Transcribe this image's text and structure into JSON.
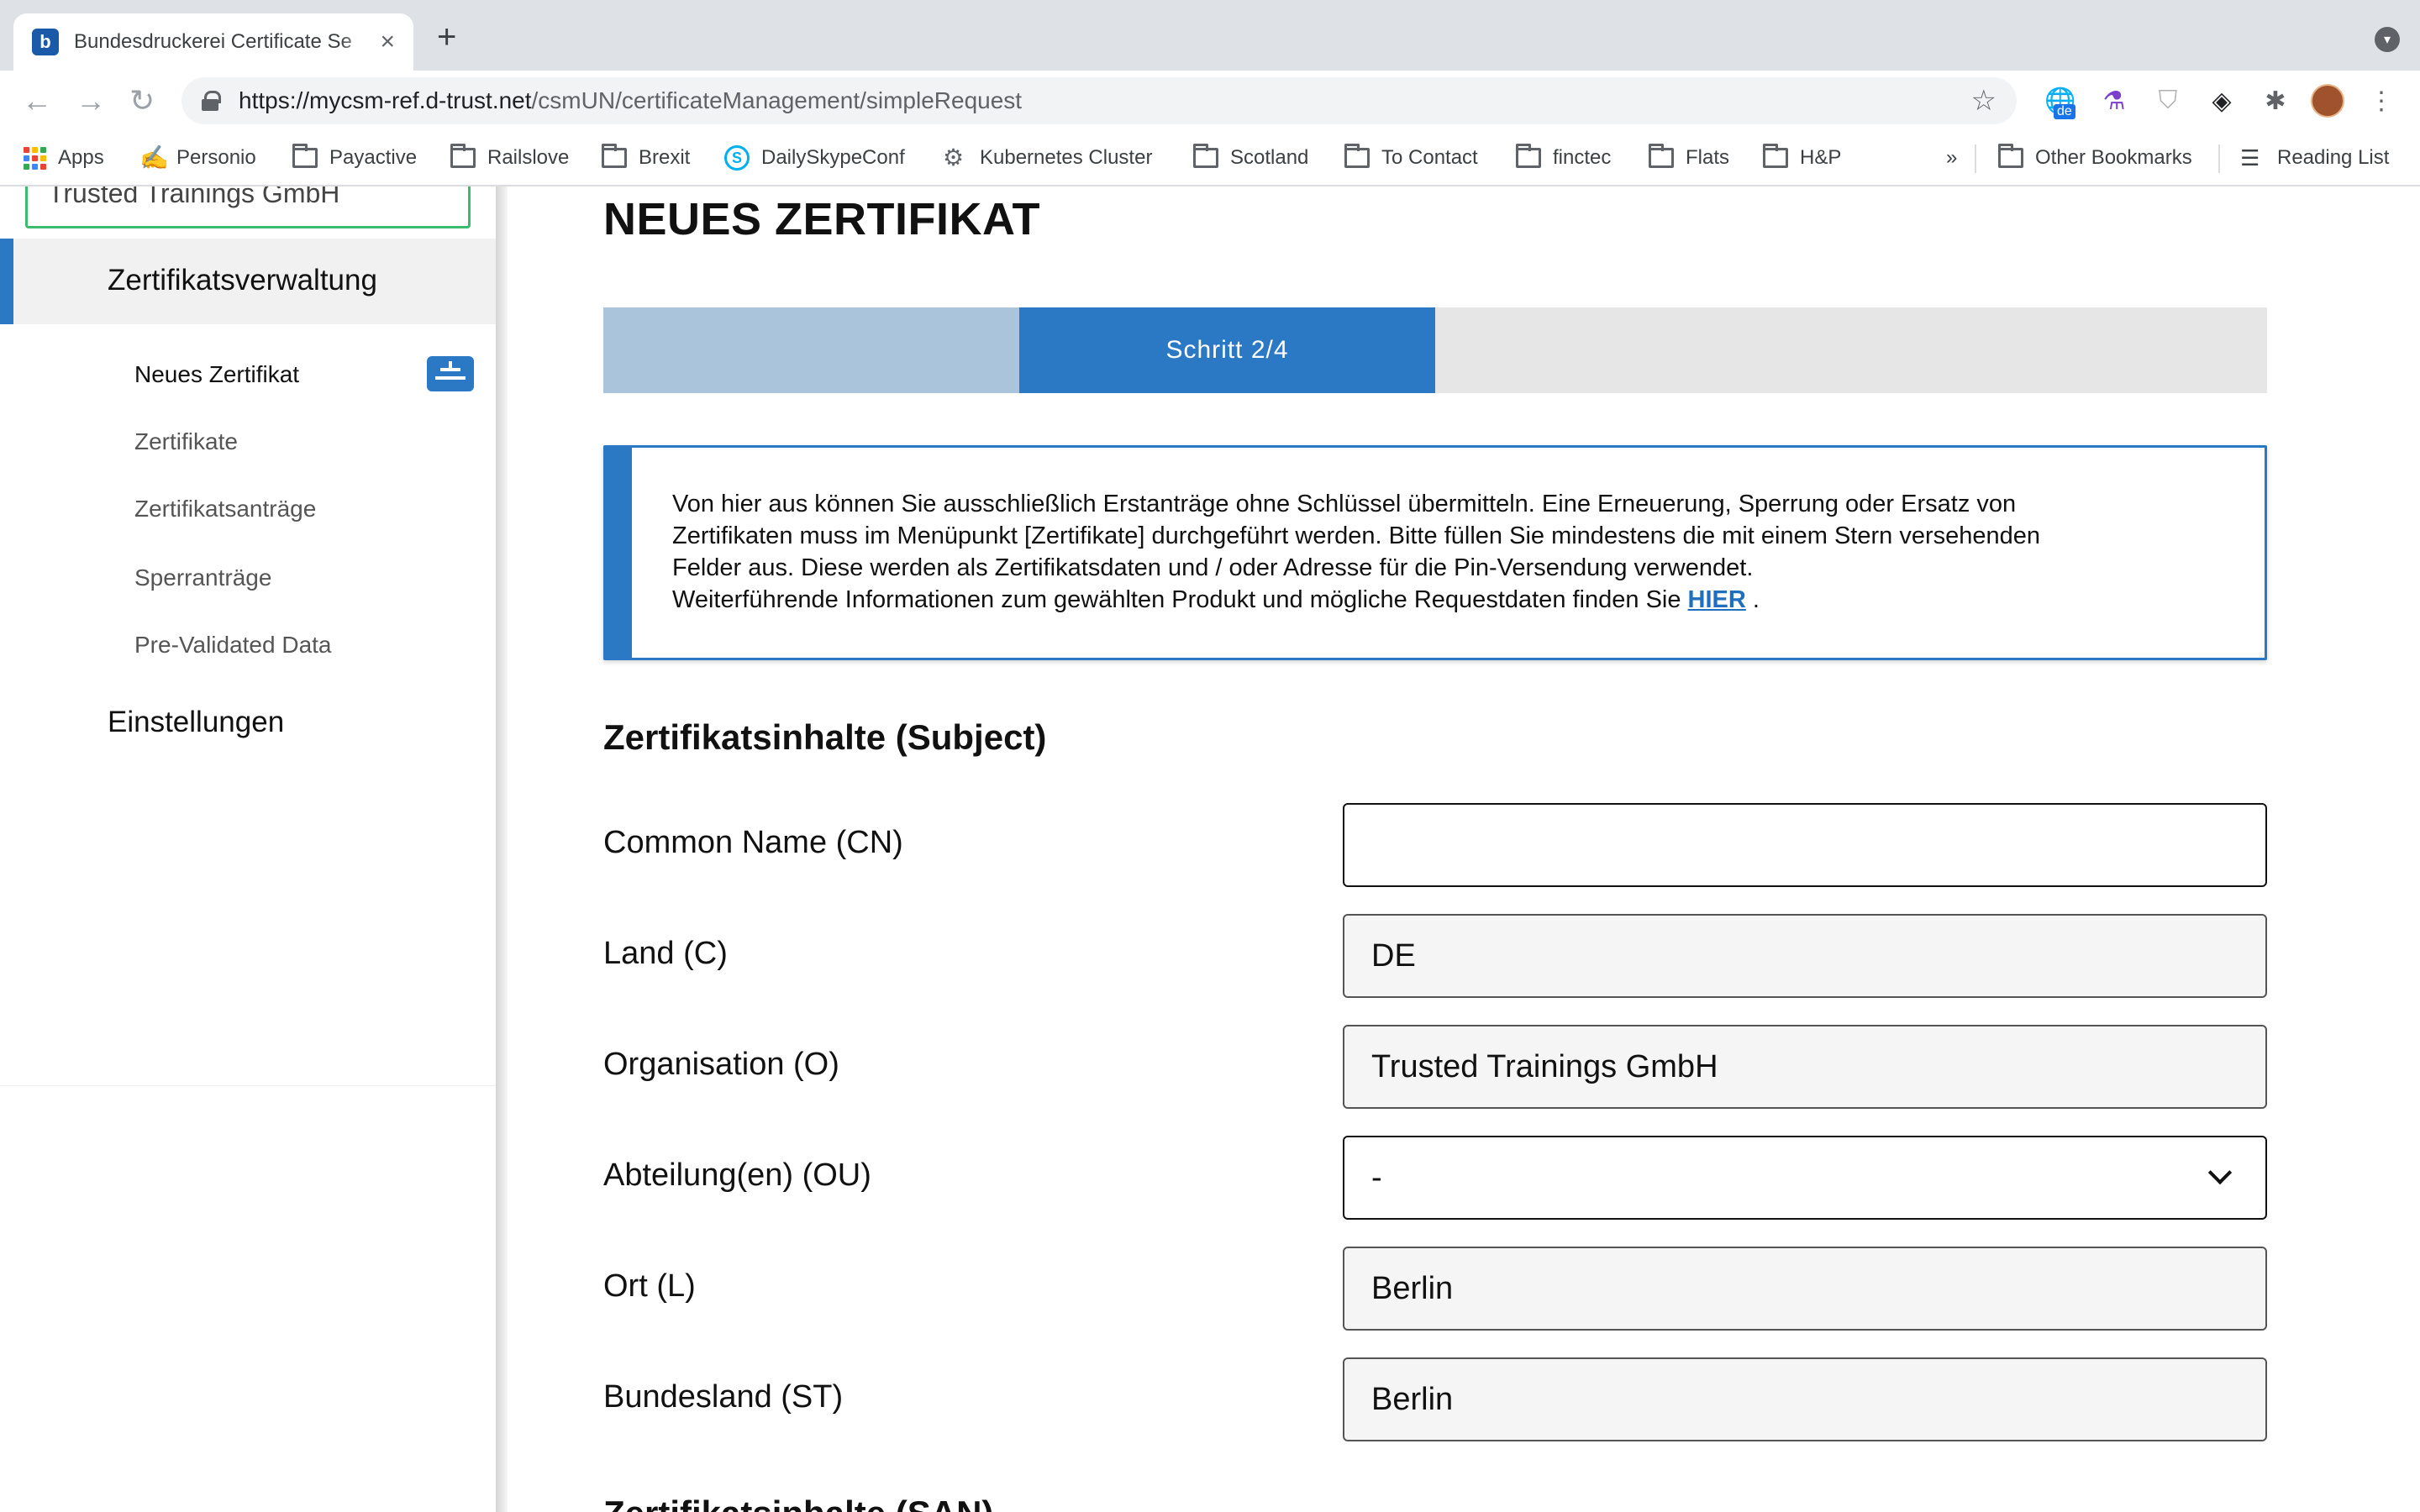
{
  "browser": {
    "tab_title": "Bundesdruckerei Certificate Se",
    "favicon_letter": "b",
    "url_host": "https://mycsm-ref.d-trust.net",
    "url_path": "/csmUN/certificateManagement/simpleRequest",
    "ext_badge": "de"
  },
  "bookmarks": {
    "apps": "Apps",
    "items": [
      "Personio",
      "Payactive",
      "Railslove",
      "Brexit",
      "DailySkypeConf",
      "Kubernetes Cluster",
      "Scotland",
      "To Contact",
      "finctec",
      "Flats",
      "H&P"
    ],
    "overflow": "»",
    "other": "Other Bookmarks",
    "reading_list": "Reading List"
  },
  "sidebar": {
    "org_name": "Trusted Trainings GmbH",
    "section": "Zertifikatsverwaltung",
    "items": [
      "Neues Zertifikat",
      "Zertifikate",
      "Zertifikatsanträge",
      "Sperranträge",
      "Pre-Validated Data"
    ],
    "settings": "Einstellungen"
  },
  "main": {
    "title": "NEUES ZERTIFIKAT",
    "step_label": "Schritt 2/4",
    "info": {
      "line1": "Von hier aus können Sie ausschließlich Erstanträge ohne Schlüssel übermitteln. Eine Erneuerung, Sperrung oder Ersatz von",
      "line2": "Zertifikaten muss im Menüpunkt [Zertifikate] durchgeführt werden. Bitte füllen Sie mindestens die mit einem Stern versehenden",
      "line3": "Felder aus. Diese werden als Zertifikatsdaten und / oder Adresse für die Pin-Versendung verwendet.",
      "line4": "Weiterführende Informationen zum gewählten Produkt und mögliche Requestdaten finden Sie",
      "link": "HIER",
      "after_link": " ."
    },
    "section_title": "Zertifikatsinhalte (Subject)",
    "fields": {
      "cn_label": "Common Name (CN)",
      "cn_value": "",
      "c_label": "Land (C)",
      "c_value": "DE",
      "o_label": "Organisation (O)",
      "o_value": "Trusted Trainings GmbH",
      "ou_label": "Abteilung(en) (OU)",
      "ou_value": "-",
      "l_label": "Ort (L)",
      "l_value": "Berlin",
      "st_label": "Bundesland (ST)",
      "st_value": "Berlin"
    },
    "next_section_title": "Zertifikatsinhalte (SAN)"
  },
  "colors": {
    "accent": "#2b78c5",
    "step_done": "#aac4dc",
    "step_todo": "#e6e6e6",
    "org_border": "#3cba6e"
  }
}
